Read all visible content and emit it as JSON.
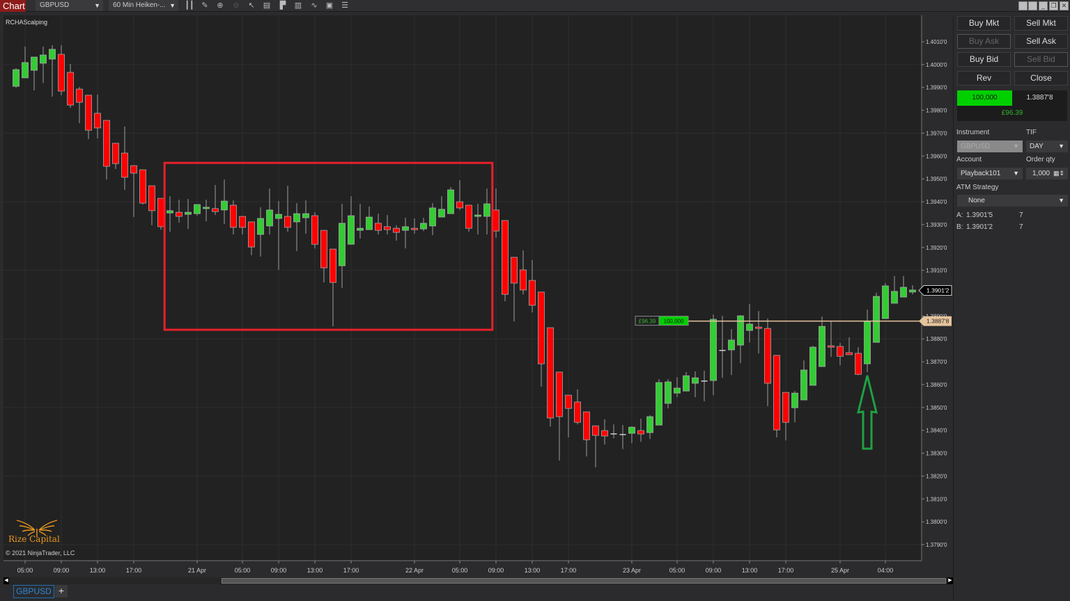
{
  "toolbar": {
    "chart_tab": "Chart",
    "instrument": "GBPUSD",
    "interval": "60 Min Heiken-...",
    "icons": [
      "bars-type-icon",
      "pencil-draw-icon",
      "zoom-in-icon",
      "zoom-out-icon",
      "pointer-icon",
      "data-box-icon",
      "chart-trader-icon",
      "indicators-icon",
      "strategies-icon",
      "properties-icon",
      "menu-list-icon"
    ],
    "window_icons": [
      "restore-icon",
      "restore-icon",
      "minimize-icon",
      "maximize-icon",
      "close-icon"
    ]
  },
  "chart": {
    "indicator": "RCHAScalping",
    "logo_text": "Rize Capital",
    "copyright": "© 2021 NinjaTrader, LLC",
    "position_pnl": "£96.39",
    "position_qty": "100,000",
    "last_price_label": "1.3901'2",
    "position_price_label": "1.3887'8"
  },
  "chart_data": {
    "type": "candlestick",
    "instrument": "GBPUSD",
    "bar_type": "60 Min Heiken-Ashi",
    "ylim": [
      1.3785,
      1.4022
    ],
    "y_ticks": [
      "1.4010'0",
      "1.4000'0",
      "1.3990'0",
      "1.3980'0",
      "1.3970'0",
      "1.3960'0",
      "1.3950'0",
      "1.3940'0",
      "1.3930'0",
      "1.3920'0",
      "1.3910'0",
      "1.3900'0",
      "1.3890'0",
      "1.3880'0",
      "1.3870'0",
      "1.3860'0",
      "1.3850'0",
      "1.3840'0",
      "1.3830'0",
      "1.3820'0",
      "1.3810'0",
      "1.3800'0",
      "1.3790'0"
    ],
    "y_tick_values": [
      1.401,
      1.4,
      1.399,
      1.398,
      1.397,
      1.396,
      1.395,
      1.394,
      1.393,
      1.392,
      1.391,
      1.39,
      1.389,
      1.388,
      1.387,
      1.386,
      1.385,
      1.384,
      1.383,
      1.382,
      1.381,
      1.38,
      1.379
    ],
    "x_ticks": [
      {
        "bar": 1,
        "label": "05:00"
      },
      {
        "bar": 5,
        "label": "09:00"
      },
      {
        "bar": 9,
        "label": "13:00"
      },
      {
        "bar": 13,
        "label": "17:00"
      },
      {
        "bar": 20,
        "label": "21 Apr"
      },
      {
        "bar": 25,
        "label": "05:00"
      },
      {
        "bar": 29,
        "label": "09:00"
      },
      {
        "bar": 33,
        "label": "13:00"
      },
      {
        "bar": 37,
        "label": "17:00"
      },
      {
        "bar": 44,
        "label": "22 Apr"
      },
      {
        "bar": 49,
        "label": "05:00"
      },
      {
        "bar": 53,
        "label": "09:00"
      },
      {
        "bar": 57,
        "label": "13:00"
      },
      {
        "bar": 61,
        "label": "17:00"
      },
      {
        "bar": 68,
        "label": "23 Apr"
      },
      {
        "bar": 73,
        "label": "05:00"
      },
      {
        "bar": 77,
        "label": "09:00"
      },
      {
        "bar": 81,
        "label": "13:00"
      },
      {
        "bar": 85,
        "label": "17:00"
      },
      {
        "bar": 91,
        "label": "25 Apr"
      },
      {
        "bar": 96,
        "label": "04:00"
      }
    ],
    "candles_ohlc": [
      [
        1.39905,
        1.39984,
        1.39899,
        1.39978
      ],
      [
        1.39942,
        1.40079,
        1.39942,
        1.40009
      ],
      [
        1.39975,
        1.40033,
        1.39887,
        1.40033
      ],
      [
        1.40006,
        1.40079,
        1.3992,
        1.40042
      ],
      [
        1.40024,
        1.40085,
        1.3986,
        1.40067
      ],
      [
        1.40045,
        1.40085,
        1.39866,
        1.39884
      ],
      [
        1.39966,
        1.40003,
        1.39811,
        1.39823
      ],
      [
        1.39893,
        1.39902,
        1.39744,
        1.39835
      ],
      [
        1.39866,
        1.39866,
        1.39674,
        1.39713
      ],
      [
        1.39787,
        1.39869,
        1.39677,
        1.39723
      ],
      [
        1.39756,
        1.39756,
        1.39497,
        1.39555
      ],
      [
        1.39656,
        1.39656,
        1.39543,
        1.39567
      ],
      [
        1.39613,
        1.39729,
        1.39452,
        1.39507
      ],
      [
        1.39558,
        1.39558,
        1.39333,
        1.39525
      ],
      [
        1.3954,
        1.3954,
        1.39388,
        1.39394
      ],
      [
        1.3947,
        1.3947,
        1.39297,
        1.39361
      ],
      [
        1.39415,
        1.39415,
        1.39278,
        1.39291
      ],
      [
        1.39351,
        1.39424,
        1.39269,
        1.39361
      ],
      [
        1.39354,
        1.39409,
        1.39309,
        1.39336
      ],
      [
        1.39345,
        1.39412,
        1.39281,
        1.39354
      ],
      [
        1.39348,
        1.39388,
        1.39339,
        1.39388
      ],
      [
        1.3937,
        1.39409,
        1.39315,
        1.39376
      ],
      [
        1.3937,
        1.39473,
        1.39342,
        1.39357
      ],
      [
        1.39364,
        1.39497,
        1.39303,
        1.39403
      ],
      [
        1.39385,
        1.39406,
        1.39257,
        1.39288
      ],
      [
        1.39336,
        1.39336,
        1.39257,
        1.39288
      ],
      [
        1.39312,
        1.39312,
        1.39166,
        1.39202
      ],
      [
        1.39257,
        1.39376,
        1.3916,
        1.39327
      ],
      [
        1.39294,
        1.39458,
        1.39257,
        1.39364
      ],
      [
        1.39327,
        1.39403,
        1.39102,
        1.39345
      ],
      [
        1.39336,
        1.3947,
        1.39269,
        1.39288
      ],
      [
        1.39312,
        1.39394,
        1.39184,
        1.39348
      ],
      [
        1.3933,
        1.39406,
        1.3926,
        1.39348
      ],
      [
        1.39339,
        1.39354,
        1.39196,
        1.39214
      ],
      [
        1.39275,
        1.39275,
        1.39047,
        1.39111
      ],
      [
        1.39193,
        1.39193,
        1.38855,
        1.39047
      ],
      [
        1.3912,
        1.39391,
        1.39023,
        1.39306
      ],
      [
        1.39214,
        1.39424,
        1.39214,
        1.39339
      ],
      [
        1.39275,
        1.39391,
        1.39239,
        1.39284
      ],
      [
        1.39278,
        1.39379,
        1.39278,
        1.39333
      ],
      [
        1.39306,
        1.39348,
        1.39257,
        1.39275
      ],
      [
        1.39291,
        1.39342,
        1.39257,
        1.39278
      ],
      [
        1.39284,
        1.39297,
        1.3923,
        1.39266
      ],
      [
        1.39275,
        1.3933,
        1.39196,
        1.39291
      ],
      [
        1.39284,
        1.39327,
        1.3926,
        1.39278
      ],
      [
        1.39281,
        1.3933,
        1.39272,
        1.39306
      ],
      [
        1.39294,
        1.39394,
        1.39254,
        1.39373
      ],
      [
        1.39333,
        1.39424,
        1.39333,
        1.39367
      ],
      [
        1.39348,
        1.39464,
        1.39348,
        1.39452
      ],
      [
        1.394,
        1.39494,
        1.39364,
        1.39373
      ],
      [
        1.39385,
        1.39385,
        1.39269,
        1.39284
      ],
      [
        1.39336,
        1.39391,
        1.39257,
        1.39342
      ],
      [
        1.39336,
        1.39458,
        1.39257,
        1.39391
      ],
      [
        1.39364,
        1.39458,
        1.39242,
        1.39272
      ],
      [
        1.39318,
        1.39318,
        1.38965,
        1.38995
      ],
      [
        1.39157,
        1.39157,
        1.38877,
        1.39044
      ],
      [
        1.39102,
        1.39187,
        1.38995,
        1.39014
      ],
      [
        1.39056,
        1.39145,
        1.38916,
        1.38947
      ],
      [
        1.39005,
        1.39005,
        1.38591,
        1.38691
      ],
      [
        1.38849,
        1.38849,
        1.38417,
        1.38454
      ],
      [
        1.38655,
        1.38655,
        1.38268,
        1.3846
      ],
      [
        1.38554,
        1.38554,
        1.38369,
        1.38496
      ],
      [
        1.38524,
        1.38579,
        1.38426,
        1.38435
      ],
      [
        1.38481,
        1.38481,
        1.38286,
        1.38359
      ],
      [
        1.3842,
        1.3842,
        1.38238,
        1.38378
      ],
      [
        1.38399,
        1.38448,
        1.38338,
        1.38375
      ],
      [
        1.38387,
        1.38426,
        1.38365,
        1.38387
      ],
      [
        1.38384,
        1.38423,
        1.38318,
        1.38384
      ],
      [
        1.38387,
        1.38417,
        1.38344,
        1.38414
      ],
      [
        1.38399,
        1.38451,
        1.3835,
        1.38384
      ],
      [
        1.3839,
        1.38466,
        1.38362,
        1.3846
      ],
      [
        1.38423,
        1.38624,
        1.38423,
        1.38609
      ],
      [
        1.38518,
        1.38624,
        1.38496,
        1.38612
      ],
      [
        1.38563,
        1.38633,
        1.38545,
        1.38585
      ],
      [
        1.38572,
        1.38655,
        1.38572,
        1.38639
      ],
      [
        1.38606,
        1.38658,
        1.38545,
        1.3863
      ],
      [
        1.38618,
        1.38661,
        1.38527,
        1.38618
      ],
      [
        1.38618,
        1.38907,
        1.38554,
        1.38886
      ],
      [
        1.38752,
        1.38901,
        1.3863,
        1.38752
      ],
      [
        1.38752,
        1.38843,
        1.38642,
        1.38795
      ],
      [
        1.38773,
        1.38904,
        1.38694,
        1.38901
      ],
      [
        1.38837,
        1.38953,
        1.38785,
        1.38865
      ],
      [
        1.38852,
        1.38922,
        1.38737,
        1.38846
      ],
      [
        1.38846,
        1.38889,
        1.38506,
        1.38606
      ],
      [
        1.38728,
        1.38728,
        1.38369,
        1.38402
      ],
      [
        1.38566,
        1.38566,
        1.38356,
        1.38435
      ],
      [
        1.38499,
        1.38572,
        1.38435,
        1.38563
      ],
      [
        1.38533,
        1.38706,
        1.38533,
        1.38664
      ],
      [
        1.38597,
        1.3877,
        1.38597,
        1.38764
      ],
      [
        1.38679,
        1.38898,
        1.38679,
        1.38855
      ],
      [
        1.3877,
        1.38877,
        1.38721,
        1.38764
      ],
      [
        1.38767,
        1.38782,
        1.38685,
        1.38724
      ],
      [
        1.3874,
        1.38807,
        1.38731,
        1.38731
      ],
      [
        1.38737,
        1.38764,
        1.38642,
        1.38645
      ],
      [
        1.38691,
        1.38928,
        1.38655,
        1.38877
      ],
      [
        1.38785,
        1.39002,
        1.38785,
        1.38986
      ],
      [
        1.38889,
        1.39044,
        1.38889,
        1.39032
      ],
      [
        1.38956,
        1.39075,
        1.38956,
        1.39008
      ],
      [
        1.38983,
        1.39075,
        1.38983,
        1.39026
      ],
      [
        1.39005,
        1.39035,
        1.38995,
        1.39014
      ]
    ],
    "last_price": 1.39012,
    "position_price": 1.38878,
    "annotations": {
      "range_box": {
        "bar_from": 16.4,
        "bar_to": 52.6,
        "price_top": 1.3957,
        "price_bottom": 1.3884,
        "color": "#e8202a"
      },
      "up_arrow": {
        "bar": 94,
        "price_tip": 1.3864,
        "price_base": 1.3832,
        "color": "#1fa043"
      }
    },
    "colors": {
      "up": "#33cc33",
      "down": "#ff0000",
      "position_line": "#e6c49c",
      "grid": "#2e2e2e"
    }
  },
  "panel": {
    "buttons": [
      {
        "label": "Buy Mkt",
        "enabled": true
      },
      {
        "label": "Sell Mkt",
        "enabled": true
      },
      {
        "label": "Buy Ask",
        "enabled": false
      },
      {
        "label": "Sell Ask",
        "enabled": true
      },
      {
        "label": "Buy Bid",
        "enabled": true
      },
      {
        "label": "Sell Bid",
        "enabled": false
      },
      {
        "label": "Rev",
        "enabled": true
      },
      {
        "label": "Close",
        "enabled": true
      }
    ],
    "position_qty": "100,000",
    "position_price": "1.3887'8",
    "pnl": "£96.39",
    "instrument_label": "Instrument",
    "instrument": "GBPUSD",
    "tif_label": "TIF",
    "tif": "DAY",
    "account_label": "Account",
    "account": "Playback101",
    "qty_label": "Order qty",
    "qty": "1,000",
    "atm_label": "ATM Strategy",
    "atm": "None",
    "ask_label": "A:",
    "ask": "1.3901'5",
    "ask_size": "7",
    "bid_label": "B:",
    "bid": "1.3901'2",
    "bid_size": "7"
  },
  "tabs": {
    "active": "GBPUSD",
    "add": "+"
  }
}
